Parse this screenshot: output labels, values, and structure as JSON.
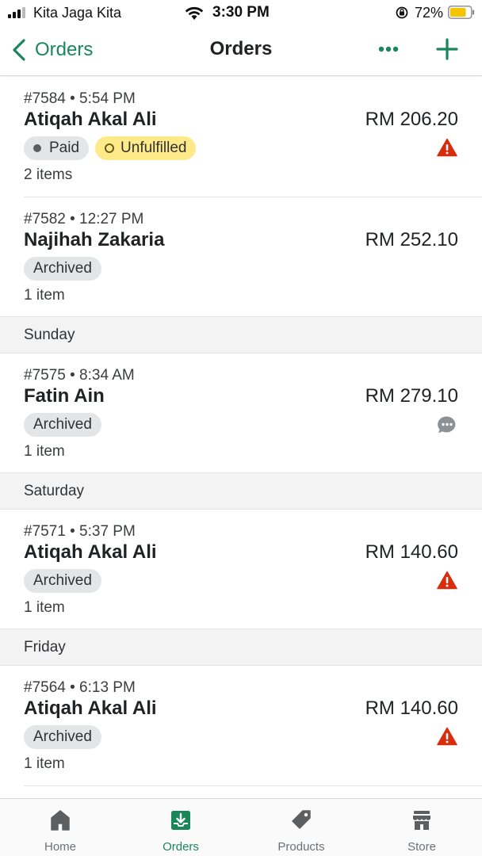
{
  "status_bar": {
    "carrier": "Kita Jaga Kita",
    "time": "3:30 PM",
    "battery": "72%"
  },
  "nav": {
    "back_label": "Orders",
    "title": "Orders"
  },
  "orders_top": [
    {
      "meta": "#7584 • 5:54 PM",
      "customer": "Atiqah Akal Ali",
      "total": "RM 206.20",
      "badges": [
        "Paid",
        "Unfulfilled"
      ],
      "items": "2 items",
      "icon": "warning-icon"
    },
    {
      "meta": "#7582 • 12:27 PM",
      "customer": "Najihah Zakaria",
      "total": "RM 252.10",
      "badges": [
        "Archived"
      ],
      "items": "1 item",
      "icon": ""
    }
  ],
  "sections": [
    {
      "label": "Sunday",
      "order": {
        "meta": "#7575 • 8:34 AM",
        "customer": "Fatin Ain",
        "total": "RM 279.10",
        "badges": [
          "Archived"
        ],
        "items": "1 item",
        "icon": "chat-icon"
      }
    },
    {
      "label": "Saturday",
      "order": {
        "meta": "#7571 • 5:37 PM",
        "customer": "Atiqah Akal Ali",
        "total": "RM 140.60",
        "badges": [
          "Archived"
        ],
        "items": "1 item",
        "icon": "warning-icon"
      }
    },
    {
      "label": "Friday",
      "order": {
        "meta": "#7564 • 6:13 PM",
        "customer": "Atiqah Akal Ali",
        "total": "RM 140.60",
        "badges": [
          "Archived"
        ],
        "items": "1 item",
        "icon": "warning-icon"
      }
    }
  ],
  "tabs": [
    {
      "label": "Home",
      "icon": "home-icon"
    },
    {
      "label": "Orders",
      "icon": "orders-inbox-icon",
      "active": true
    },
    {
      "label": "Products",
      "icon": "tag-icon"
    },
    {
      "label": "Store",
      "icon": "storefront-icon"
    }
  ],
  "colors": {
    "accent": "#19875b",
    "warning": "#d82c0d",
    "unfulfilled_badge": "#ffea8a",
    "neutral_badge": "#e4e5e7",
    "section_bg": "#f3f3f4"
  }
}
